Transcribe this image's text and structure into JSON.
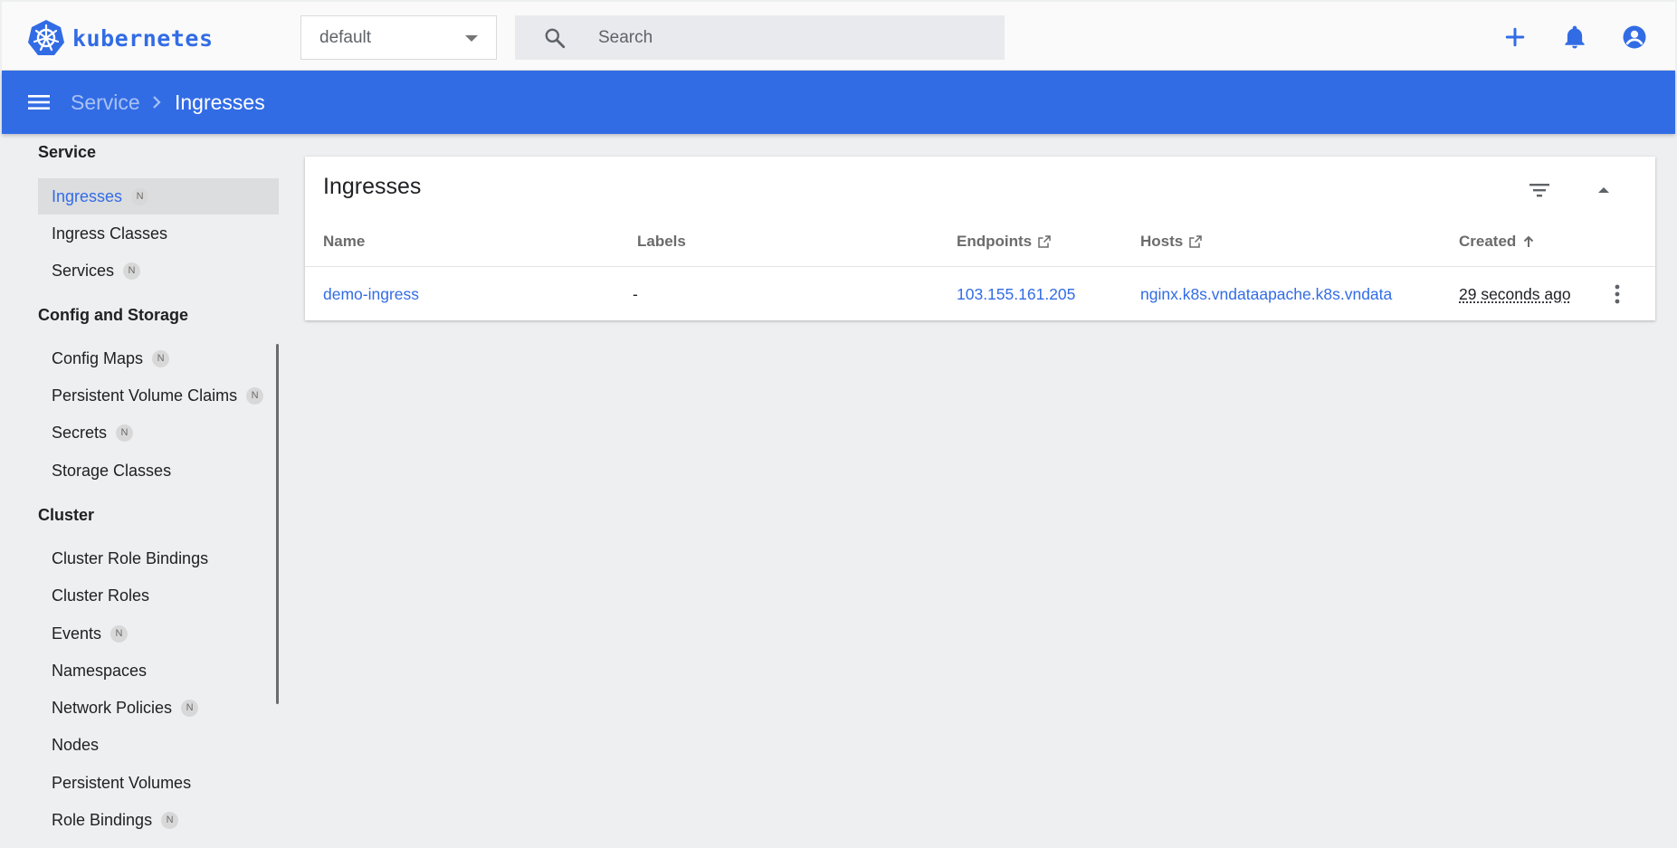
{
  "app": {
    "name": "kubernetes",
    "brand_color": "#326ce5"
  },
  "header": {
    "namespace": "default",
    "search_placeholder": "Search",
    "icons": [
      "plus-icon",
      "bell-icon",
      "account-circle-icon"
    ]
  },
  "breadcrumb": {
    "parent": "Service",
    "current": "Ingresses"
  },
  "sidebar": {
    "sections": [
      {
        "title": "Service",
        "items": [
          {
            "label": "Ingresses",
            "badge": "N",
            "active": true
          },
          {
            "label": "Ingress Classes",
            "badge": ""
          },
          {
            "label": "Services",
            "badge": "N"
          }
        ]
      },
      {
        "title": "Config and Storage",
        "items": [
          {
            "label": "Config Maps",
            "badge": "N"
          },
          {
            "label": "Persistent Volume Claims",
            "badge": "N"
          },
          {
            "label": "Secrets",
            "badge": "N"
          },
          {
            "label": "Storage Classes",
            "badge": ""
          }
        ]
      },
      {
        "title": "Cluster",
        "items": [
          {
            "label": "Cluster Role Bindings",
            "badge": ""
          },
          {
            "label": "Cluster Roles",
            "badge": ""
          },
          {
            "label": "Events",
            "badge": "N"
          },
          {
            "label": "Namespaces",
            "badge": ""
          },
          {
            "label": "Network Policies",
            "badge": "N"
          },
          {
            "label": "Nodes",
            "badge": ""
          },
          {
            "label": "Persistent Volumes",
            "badge": ""
          },
          {
            "label": "Role Bindings",
            "badge": "N"
          }
        ]
      }
    ]
  },
  "card": {
    "title": "Ingresses",
    "columns": [
      "Name",
      "Labels",
      "Endpoints",
      "Hosts",
      "Created"
    ],
    "rows": [
      {
        "name": "demo-ingress",
        "labels": "-",
        "endpoints": "103.155.161.205",
        "hosts": "nginx.k8s.vndataapache.k8s.vndata",
        "created": "29 seconds ago"
      }
    ]
  }
}
